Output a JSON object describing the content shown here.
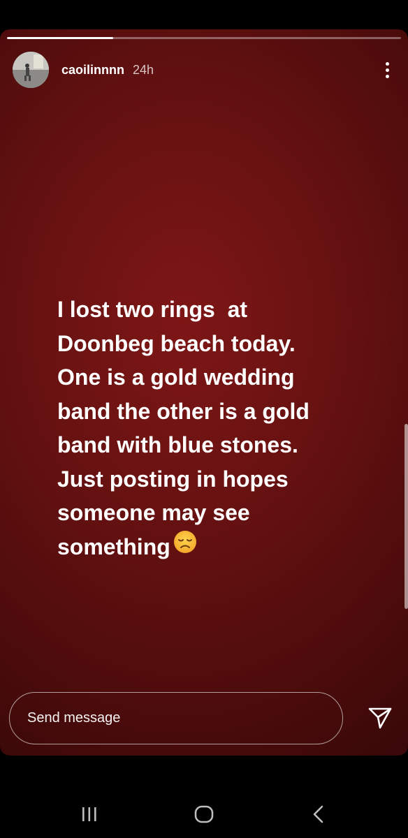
{
  "story": {
    "username": "caoilinnnn",
    "time_ago": "24h",
    "progress": 0.27,
    "text_lines": [
      "I lost two rings  at",
      "Doonbeg beach today.",
      "One is a gold wedding",
      "band the other is a gold",
      "band with blue stones.",
      "Just posting in hopes",
      "someone may see",
      "something"
    ],
    "emoji": "disappointed-face",
    "background_color": "#6a1212"
  },
  "composer": {
    "placeholder": "Send message"
  },
  "icons": {
    "more": "more-vertical-icon",
    "send": "send-icon",
    "recents": "recents-icon",
    "home": "home-icon",
    "back": "back-icon"
  }
}
